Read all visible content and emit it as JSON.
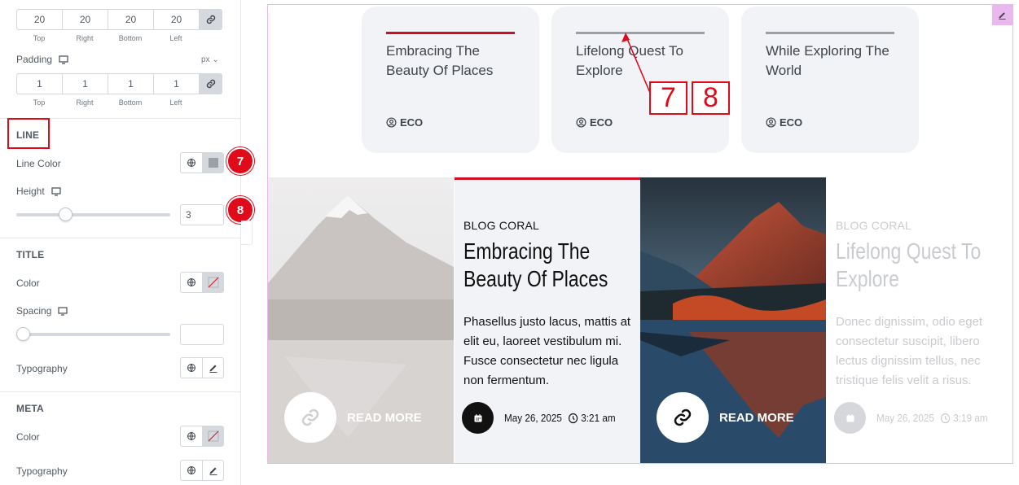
{
  "panel": {
    "margin_values": [
      "20",
      "20",
      "20",
      "20"
    ],
    "dim_labels": [
      "Top",
      "Right",
      "Bottom",
      "Left"
    ],
    "padding_label": "Padding",
    "padding_unit": "px",
    "padding_values": [
      "1",
      "1",
      "1",
      "1"
    ],
    "line_section": "LINE",
    "line_color_label": "Line Color",
    "height_label": "Height",
    "height_value": "3",
    "height_slider_level": 0.3,
    "title_section": "TITLE",
    "title_color_label": "Color",
    "spacing_label": "Spacing",
    "spacing_value": "",
    "spacing_slider_level": 0,
    "title_typography_label": "Typography",
    "meta_section": "META",
    "meta_color_label": "Color",
    "meta_typography_label": "Typography",
    "badges": [
      "7",
      "8"
    ]
  },
  "preview": {
    "cards": [
      {
        "title": "Embracing The Beauty Of Places",
        "meta": "ECO",
        "active": true
      },
      {
        "title": "Lifelong Quest To Explore",
        "meta": "ECO",
        "active": false
      },
      {
        "title": "While Exploring The World",
        "meta": "ECO",
        "active": false
      }
    ],
    "annotation_boxes": [
      "7",
      "8"
    ],
    "slides": [
      {
        "blog": "BLOG CORAL",
        "title": "Embracing The Beauty Of Places",
        "excerpt": "Phasellus justo lacus, mattis at elit eu, laoreet vestibulum mi. Fusce consectetur nec ligula non fermentum.",
        "date": "May 26, 2025",
        "time": "3:21 am"
      },
      {
        "blog": "BLOG CORAL",
        "title": "Lifelong Quest To Explore",
        "excerpt": "Donec dignissim, odio eget consectetur suscipit, libero lectus dignissim tellus, nec tristique felis velit a risus.",
        "date": "May 26, 2025",
        "time": "3:19 am"
      }
    ],
    "read_more": "READ MORE"
  },
  "colors": {
    "accent_red": "#d00d26",
    "badge_red": "#e00a1a",
    "preview_border": "#e9b8ec"
  }
}
